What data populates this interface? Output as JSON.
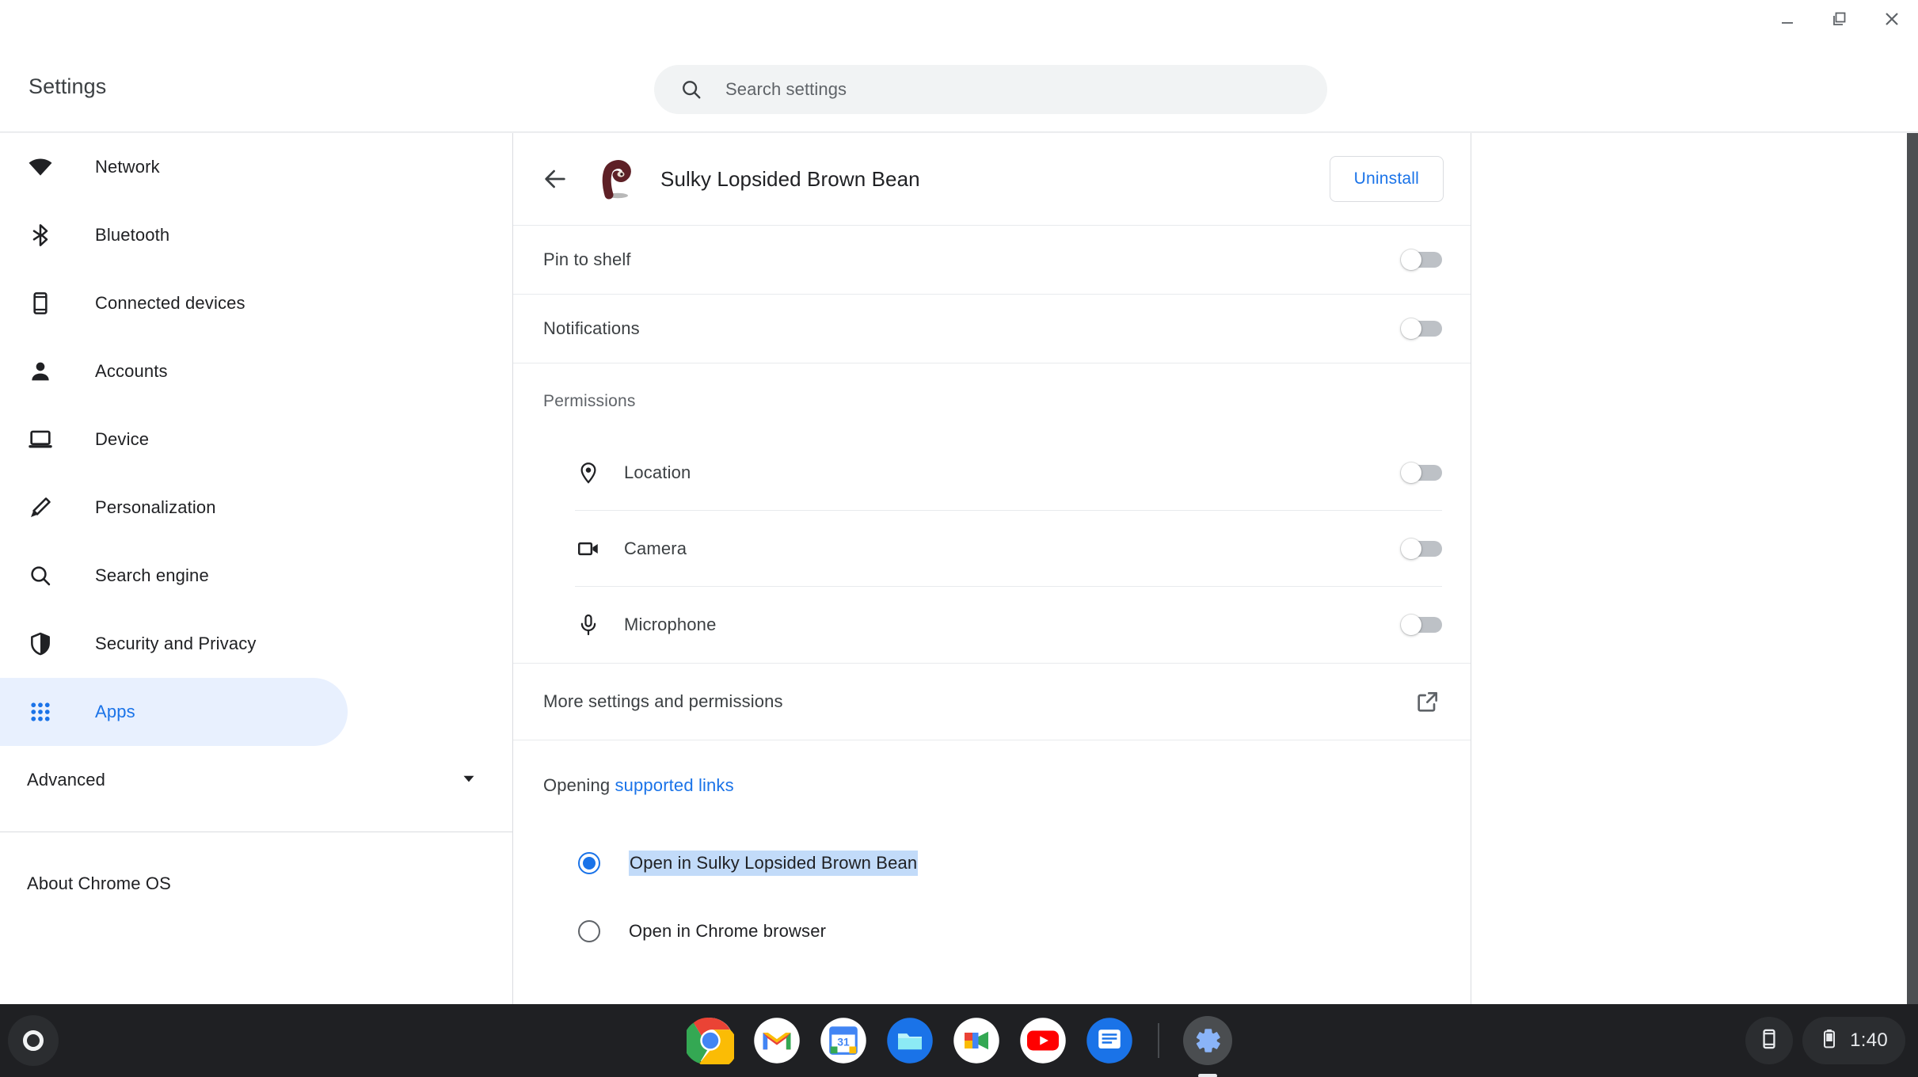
{
  "window": {
    "controls": [
      {
        "name": "minimize",
        "label": "Minimize"
      },
      {
        "name": "restore",
        "label": "Restore"
      },
      {
        "name": "close",
        "label": "Close"
      }
    ]
  },
  "topbar": {
    "title": "Settings",
    "search": {
      "icon": "search-icon",
      "placeholder": "Search settings",
      "value": ""
    }
  },
  "sidebar": {
    "items": [
      {
        "label": "Network",
        "icon": "wifi-icon",
        "selected": false
      },
      {
        "label": "Bluetooth",
        "icon": "bluetooth-icon",
        "selected": false
      },
      {
        "label": "Connected devices",
        "icon": "phone-icon",
        "selected": false
      },
      {
        "label": "Accounts",
        "icon": "person-icon",
        "selected": false
      },
      {
        "label": "Device",
        "icon": "laptop-icon",
        "selected": false
      },
      {
        "label": "Personalization",
        "icon": "pen-icon",
        "selected": false
      },
      {
        "label": "Search engine",
        "icon": "search-icon",
        "selected": false
      },
      {
        "label": "Security and Privacy",
        "icon": "shield-icon",
        "selected": false
      },
      {
        "label": "Apps",
        "icon": "apps-grid-icon",
        "selected": true
      }
    ],
    "advanced": {
      "label": "Advanced",
      "icon": "chevron-down-icon"
    },
    "about": {
      "label": "About Chrome OS"
    }
  },
  "app_detail": {
    "back_icon": "arrow-back-icon",
    "app_icon": "sulky-bean-app-icon",
    "app_name": "Sulky Lopsided Brown Bean",
    "uninstall_label": "Uninstall",
    "toggles": [
      {
        "label": "Pin to shelf",
        "on": false
      },
      {
        "label": "Notifications",
        "on": false
      }
    ],
    "permissions": {
      "title": "Permissions",
      "items": [
        {
          "label": "Location",
          "icon": "location-pin-icon",
          "on": false
        },
        {
          "label": "Camera",
          "icon": "camera-icon",
          "on": false
        },
        {
          "label": "Microphone",
          "icon": "microphone-icon",
          "on": false
        }
      ]
    },
    "more_settings": {
      "label": "More settings and permissions",
      "icon": "external-link-icon"
    },
    "opening_links": {
      "prefix": "Opening",
      "link_text": "supported links",
      "options": [
        {
          "label": "Open in Sulky Lopsided Brown Bean",
          "selected": true,
          "text_highlighted": true
        },
        {
          "label": "Open in Chrome browser",
          "selected": false,
          "text_highlighted": false
        }
      ]
    }
  },
  "shelf": {
    "launcher": {
      "icon": "launcher-circle-icon"
    },
    "apps": [
      {
        "name": "Chrome",
        "icon": "chrome-icon",
        "active": false
      },
      {
        "name": "Gmail",
        "icon": "gmail-icon",
        "active": false
      },
      {
        "name": "Calendar",
        "icon": "calendar-icon",
        "active": false,
        "day": "31"
      },
      {
        "name": "Files",
        "icon": "files-icon",
        "active": false
      },
      {
        "name": "Google Meet",
        "icon": "meet-icon",
        "active": false
      },
      {
        "name": "YouTube",
        "icon": "youtube-icon",
        "active": false
      },
      {
        "name": "Chat",
        "icon": "chat-icon",
        "active": false
      },
      {
        "name": "Settings",
        "icon": "gear-icon",
        "active": true
      }
    ],
    "tray": {
      "phone_hub_icon": "phone-hub-icon",
      "battery_icon": "battery-icon",
      "time": "1:40"
    }
  },
  "colors": {
    "accent_blue": "#1a73e8",
    "selected_nav_bg": "#e8f0fe",
    "text_selection_bg": "#c2dbf9",
    "shelf_bg": "#1f2023",
    "app_icon_color": "#6b2430"
  }
}
